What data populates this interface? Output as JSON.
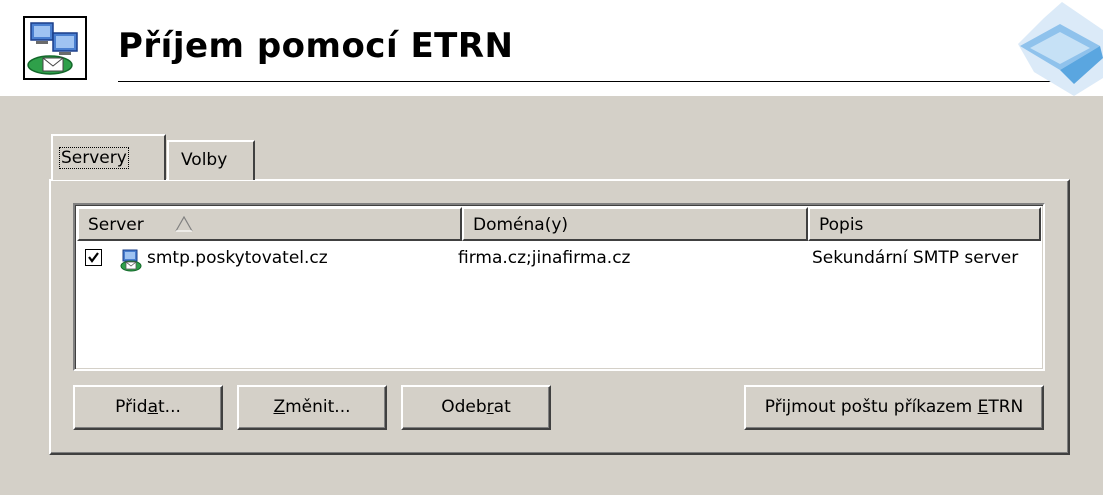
{
  "header": {
    "title": "Příjem pomocí ETRN",
    "icon": "network-mail-icon",
    "logo": "decorative-corner-logo"
  },
  "tabs": [
    {
      "label": "Servery",
      "active": true
    },
    {
      "label": "Volby",
      "active": false
    }
  ],
  "list": {
    "columns": [
      {
        "label": "Server",
        "sort": "ascending"
      },
      {
        "label": "Doména(y)"
      },
      {
        "label": "Popis"
      }
    ],
    "rows": [
      {
        "checked": true,
        "icon": "server-icon",
        "server": "smtp.poskytovatel.cz",
        "domains": "firma.cz;jinafirma.cz",
        "description": "Sekundární SMTP server"
      }
    ]
  },
  "buttons": {
    "add": {
      "before": "Přid",
      "accel": "a",
      "after": "t..."
    },
    "edit": {
      "before": "",
      "accel": "Z",
      "after": "měnit..."
    },
    "remove": {
      "before": "Odeb",
      "accel": "r",
      "after": "at"
    },
    "etrn": {
      "before": "Přijmout poštu příkazem ",
      "accel": "E",
      "after": "TRN"
    }
  },
  "colors": {
    "face": "#d4d0c8",
    "highlight": "#ffffff",
    "shadow": "#808080",
    "dark_shadow": "#404040"
  }
}
